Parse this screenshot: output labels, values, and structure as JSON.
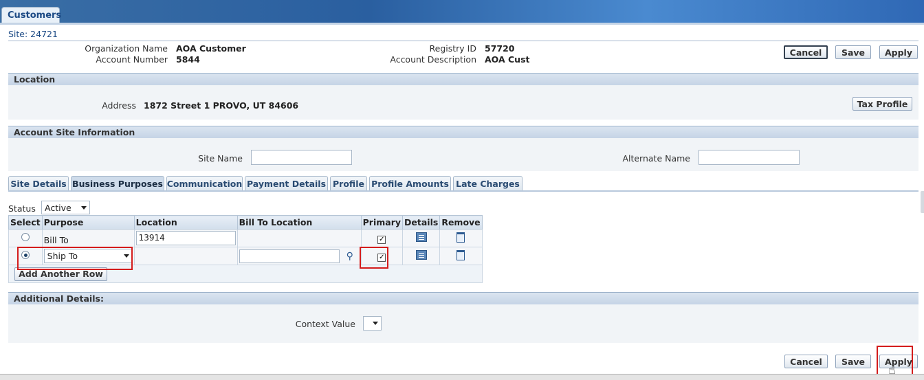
{
  "top_tab": "Customers",
  "site_title": "Site: 24721",
  "header_fields": {
    "org_name_label": "Organization Name",
    "org_name_value": "AOA Customer",
    "account_number_label": "Account Number",
    "account_number_value": "5844",
    "registry_id_label": "Registry ID",
    "registry_id_value": "57720",
    "account_desc_label": "Account Description",
    "account_desc_value": "AOA Cust"
  },
  "buttons": {
    "cancel": "Cancel",
    "save": "Save",
    "apply": "Apply",
    "tax_profile": "Tax Profile",
    "add_row": "Add Another Row"
  },
  "location": {
    "header": "Location",
    "address_label": "Address",
    "address_value": "1872 Street 1 PROVO, UT 84606"
  },
  "account_site": {
    "header": "Account Site Information",
    "site_name_label": "Site Name",
    "site_name_value": "",
    "alt_name_label": "Alternate Name",
    "alt_name_value": ""
  },
  "tabs": [
    "Site Details",
    "Business Purposes",
    "Communication",
    "Payment Details",
    "Profile",
    "Profile Amounts",
    "Late Charges"
  ],
  "status": {
    "label": "Status",
    "value": "Active"
  },
  "table": {
    "headers": [
      "Select",
      "Purpose",
      "Location",
      "Bill To Location",
      "Primary",
      "Details",
      "Remove"
    ],
    "rows": [
      {
        "purpose": "Bill To",
        "location": "13914",
        "bill_to_location": "",
        "primary": true
      },
      {
        "purpose": "Ship To",
        "location": "",
        "bill_to_location": "",
        "primary": true
      }
    ]
  },
  "additional": {
    "header": "Additional Details:",
    "context_label": "Context Value",
    "context_value": ""
  },
  "colors": {
    "accent_blue": "#1c4a85",
    "highlight_red": "#d41c1c",
    "header_band": "#c5d4e6"
  }
}
